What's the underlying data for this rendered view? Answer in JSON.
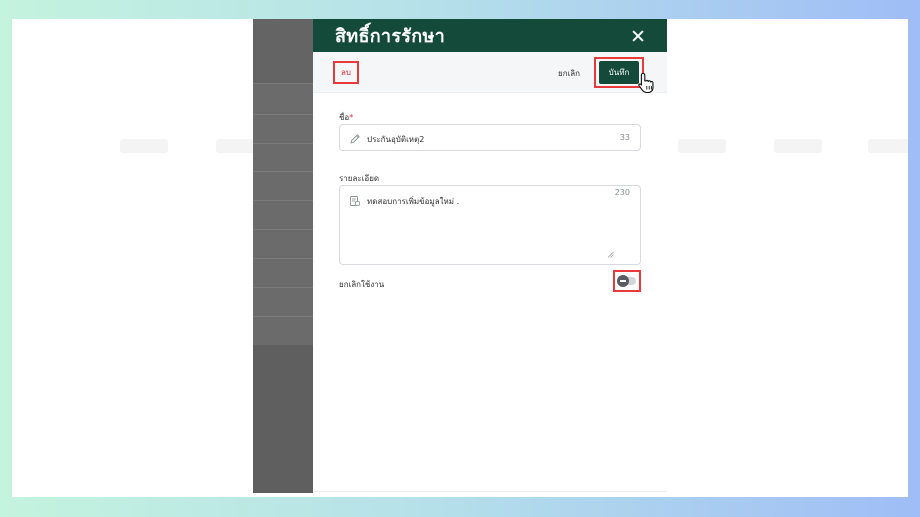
{
  "panel": {
    "title": "สิทธิ์การรักษา",
    "close_icon": "close-icon"
  },
  "toolbar": {
    "delete_label": "ลบ",
    "cancel_label": "ยกเลิก",
    "save_label": "บันทึก",
    "cursor_icon": "hand-pointer-icon"
  },
  "form": {
    "name": {
      "label": "ชื่อ",
      "required_mark": "*",
      "value": "ประกันอุบัติเหตุ2",
      "remaining": "33",
      "icon": "pencil-icon"
    },
    "detail": {
      "label": "รายละเอียด",
      "value": "ทดสอบการเพิ่มข้อมูลใหม่ .",
      "remaining": "230",
      "icon": "note-icon"
    },
    "deactivate": {
      "label": "ยกเลิกใช้งาน",
      "enabled": false
    }
  },
  "colors": {
    "header_bg": "#144a39",
    "primary_button": "#144a39",
    "highlight_border": "#e83a3a",
    "delete_text": "#e0302f"
  }
}
